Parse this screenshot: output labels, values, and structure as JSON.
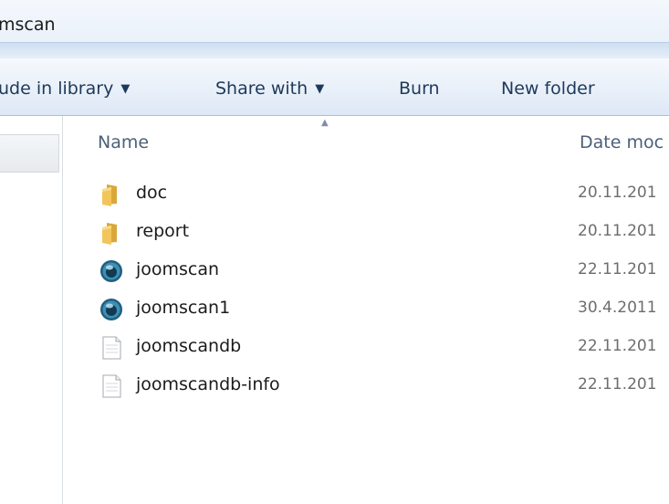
{
  "window": {
    "title": "mscan"
  },
  "toolbar": {
    "include_in_library_label": "ude in library",
    "share_with_label": "Share with",
    "burn_label": "Burn",
    "new_folder_label": "New folder",
    "dropdown_glyph": "▼"
  },
  "columns": {
    "sort_glyph": "▲",
    "name": "Name",
    "date_modified": "Date moc"
  },
  "files": [
    {
      "name": "doc",
      "date": "20.11.201",
      "icon": "folder-icon"
    },
    {
      "name": "report",
      "date": "20.11.201",
      "icon": "folder-icon"
    },
    {
      "name": "joomscan",
      "date": "22.11.201",
      "icon": "perl-script-icon"
    },
    {
      "name": "joomscan1",
      "date": "30.4.2011",
      "icon": "perl-script-icon"
    },
    {
      "name": "joomscandb",
      "date": "22.11.201",
      "icon": "document-icon"
    },
    {
      "name": "joomscandb-info",
      "date": "22.11.201",
      "icon": "document-icon"
    }
  ],
  "colors": {
    "toolbar_text": "#1e395b",
    "folder": "#e7b84a",
    "perl_globe": "#2a6c8c"
  }
}
